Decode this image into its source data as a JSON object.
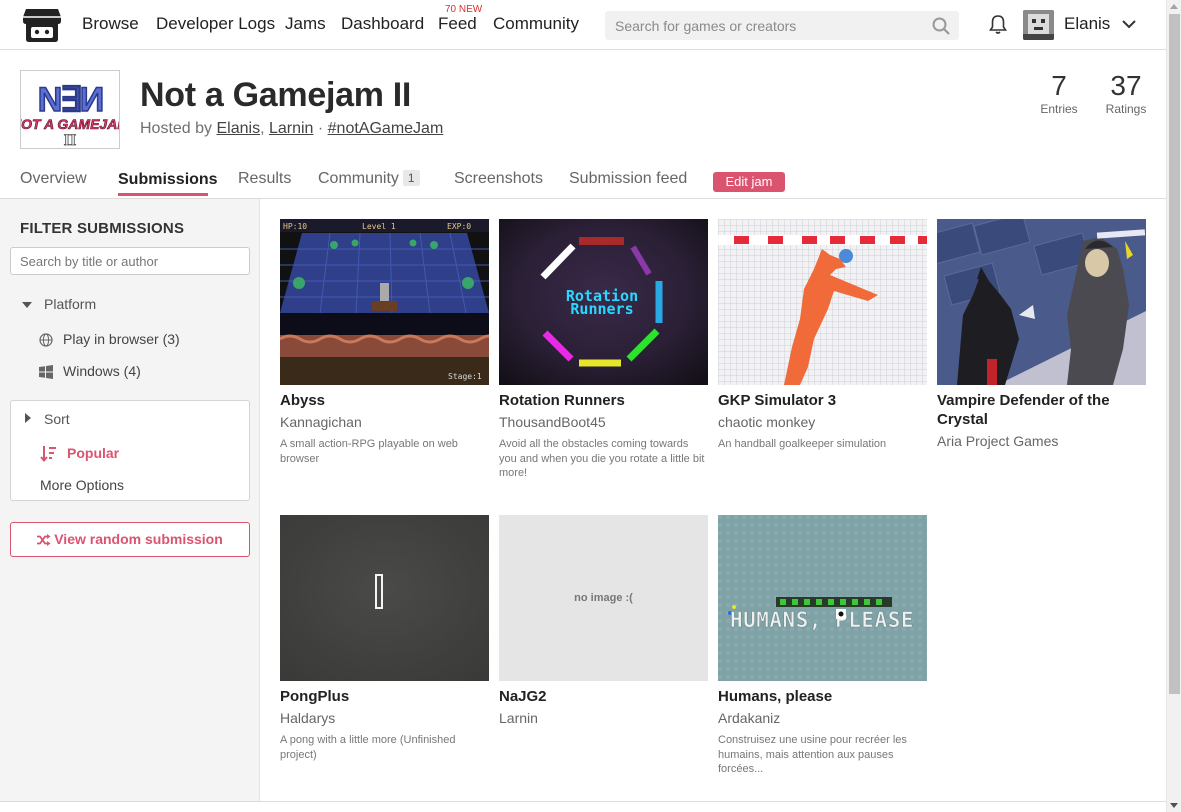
{
  "nav": {
    "links": [
      "Browse",
      "Developer Logs",
      "Jams",
      "Dashboard",
      "Feed",
      "Community"
    ],
    "feed_badge": "70 NEW",
    "search_placeholder": "Search for games or creators",
    "username": "Elanis",
    "icons": [
      "itchio-logo-icon",
      "search-icon",
      "bell-icon",
      "chevron-down-icon"
    ]
  },
  "jam": {
    "title": "Not a Gamejam II",
    "hosted_by_prefix": "Hosted by ",
    "hosts": [
      "Elanis",
      "Larnin"
    ],
    "hashtag": "#notAGameJam",
    "stats": [
      {
        "value": "7",
        "label": "Entries"
      },
      {
        "value": "37",
        "label": "Ratings"
      }
    ]
  },
  "tabs": [
    {
      "label": "Overview",
      "active": false
    },
    {
      "label": "Submissions",
      "active": true
    },
    {
      "label": "Results",
      "active": false
    },
    {
      "label": "Community",
      "active": false,
      "count": "1"
    },
    {
      "label": "Screenshots",
      "active": false
    },
    {
      "label": "Submission feed",
      "active": false
    }
  ],
  "edit_jam_label": "Edit jam",
  "sidebar": {
    "title": "FILTER SUBMISSIONS",
    "search_placeholder": "Search by title or author",
    "platform_label": "Platform",
    "platforms": [
      {
        "label": "Play in browser (3)",
        "icon": "globe-icon"
      },
      {
        "label": "Windows (4)",
        "icon": "windows-icon"
      }
    ],
    "sort_label": "Sort",
    "sort_selected": "Popular",
    "more_options": "More Options",
    "random_label": "View random submission"
  },
  "submissions": [
    {
      "title": "Abyss",
      "author": "Kannagichan",
      "description": "A small action-RPG playable on web browser",
      "thumb_texts": [
        "HP:10",
        "Level 1",
        "EXP:0",
        "Stage:1"
      ]
    },
    {
      "title": "Rotation Runners",
      "author": "ThousandBoot45",
      "description": "Avoid all the obstacles coming towards you and when you die you rotate a little bit more!",
      "thumb_texts": [
        "Rotation",
        "Runners"
      ]
    },
    {
      "title": "GKP Simulator 3",
      "author": "chaotic monkey",
      "description": "An handball goalkeeper simulation"
    },
    {
      "title": "Vampire Defender of the Crystal",
      "author": "Aria Project Games",
      "description": ""
    },
    {
      "title": "PongPlus",
      "author": "Haldarys",
      "description": "A pong with a little more (Unfinished project)"
    },
    {
      "title": "NaJG2",
      "author": "Larnin",
      "description": "",
      "no_image_text": "no image :("
    },
    {
      "title": "Humans, please",
      "author": "Ardakaniz",
      "description": "Construisez une usine pour recréer les humains, mais attention aux pauses forcées...",
      "thumb_texts": [
        "HUMANS, PLEASE"
      ]
    }
  ],
  "colors": {
    "accent": "#da5470",
    "sidebar_bg": "#f4f4f4"
  }
}
